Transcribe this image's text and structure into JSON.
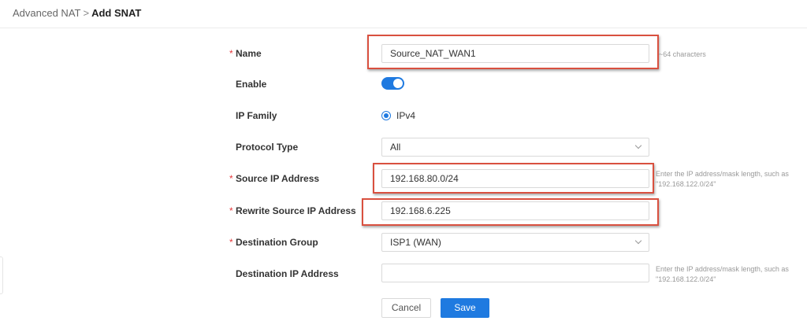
{
  "breadcrumb": {
    "parent": "Advanced NAT",
    "separator": ">",
    "current": "Add SNAT"
  },
  "form": {
    "name": {
      "label": "Name",
      "required": true,
      "value": "Source_NAT_WAN1",
      "hint": "~64 characters"
    },
    "enable": {
      "label": "Enable",
      "on": true
    },
    "ip_family": {
      "label": "IP Family",
      "option": "IPv4",
      "selected": true
    },
    "protocol_type": {
      "label": "Protocol Type",
      "value": "All"
    },
    "source_ip": {
      "label": "Source IP Address",
      "required": true,
      "value": "192.168.80.0/24",
      "hint_line1": "Enter the IP address/mask length, such as",
      "hint_line2": "\"192.168.122.0/24\""
    },
    "rewrite_source_ip": {
      "label": "Rewrite Source IP Address",
      "required": true,
      "value": "192.168.6.225"
    },
    "destination_group": {
      "label": "Destination Group",
      "required": true,
      "value": "ISP1 (WAN)"
    },
    "destination_ip": {
      "label": "Destination IP Address",
      "value": "",
      "hint_line1": "Enter the IP address/mask length, such as",
      "hint_line2": "\"192.168.122.0/24\""
    }
  },
  "buttons": {
    "cancel": "Cancel",
    "save": "Save"
  },
  "colors": {
    "accent": "#1f7ae0",
    "highlight": "#d9503f",
    "required": "#e5383b"
  }
}
